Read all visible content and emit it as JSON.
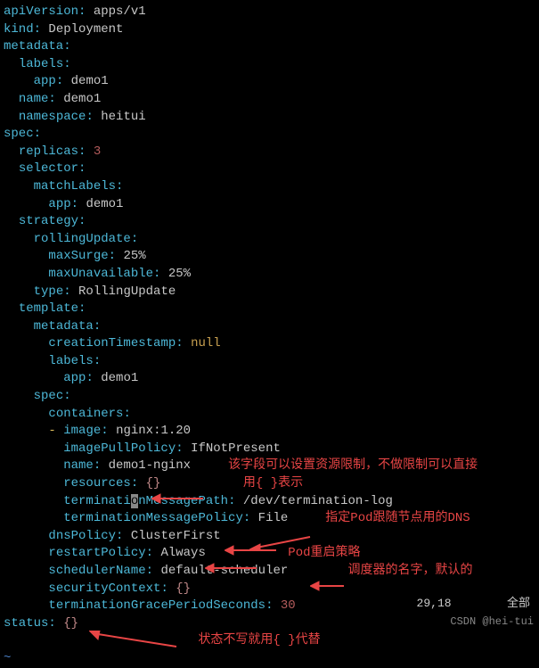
{
  "yaml": {
    "apiVersion_k": "apiVersion",
    "apiVersion_v": "apps/v1",
    "kind_k": "kind",
    "kind_v": "Deployment",
    "metadata_k": "metadata",
    "labels_k": "labels",
    "app_k": "app",
    "app_v": "demo1",
    "name_k": "name",
    "name_v": "demo1",
    "namespace_k": "namespace",
    "namespace_v": "heitui",
    "spec_k": "spec",
    "replicas_k": "replicas",
    "replicas_v": "3",
    "selector_k": "selector",
    "matchLabels_k": "matchLabels",
    "strategy_k": "strategy",
    "rollingUpdate_k": "rollingUpdate",
    "maxSurge_k": "maxSurge",
    "maxSurge_v": "25%",
    "maxUnavailable_k": "maxUnavailable",
    "maxUnavailable_v": "25%",
    "type_k": "type",
    "type_v": "RollingUpdate",
    "template_k": "template",
    "creationTimestamp_k": "creationTimestamp",
    "creationTimestamp_v": "null",
    "containers_k": "containers",
    "image_k": "image",
    "image_v": "nginx:1.20",
    "imagePullPolicy_k": "imagePullPolicy",
    "imagePullPolicy_v": "IfNotPresent",
    "cname_k": "name",
    "cname_v": "demo1-nginx",
    "resources_k": "resources",
    "resources_v": "{}",
    "tmp_k_pre": "terminati",
    "tmp_k_cursor": "o",
    "tmp_k_post": "nMessagePath",
    "tmp_v": "/dev/termination-log",
    "tmpolicy_k": "terminationMessagePolicy",
    "tmpolicy_v": "File",
    "dnsPolicy_k": "dnsPolicy",
    "dnsPolicy_v": "ClusterFirst",
    "restartPolicy_k": "restartPolicy",
    "restartPolicy_v": "Always",
    "schedulerName_k": "schedulerName",
    "schedulerName_v": "default-scheduler",
    "securityContext_k": "securityContext",
    "securityContext_v": "{}",
    "tgps_k": "terminationGracePeriodSeconds",
    "tgps_v": "30",
    "status_k": "status",
    "status_v": "{}"
  },
  "annotations": {
    "a1_line1": "该字段可以设置资源限制，不做限制可以直接",
    "a1_line2": "用{ }表示",
    "a2": "指定Pod跟随节点用的DNS",
    "a3": "Pod重启策略",
    "a4": "调度器的名字，默认的",
    "a5": "状态不写就用{ }代替"
  },
  "statusbar": {
    "pos": "29,18",
    "mode": "全部"
  },
  "watermark": "CSDN @hei-tui",
  "tilde": "~"
}
